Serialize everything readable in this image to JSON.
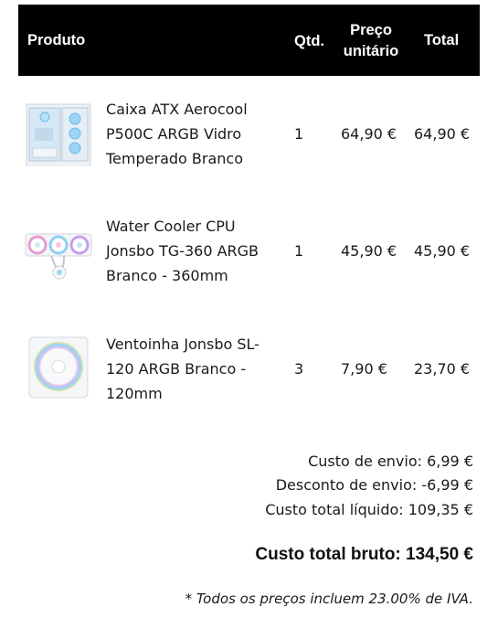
{
  "table": {
    "headers": {
      "product": "Produto",
      "qty": "Qtd.",
      "unit_price_line1": "Preço",
      "unit_price_line2": "unitário",
      "total": "Total"
    },
    "rows": [
      {
        "name_lines": [
          "Caixa ATX Aerocool",
          "P500C ARGB Vidro",
          "Temperado Branco"
        ],
        "qty": "1",
        "unit_price": "64,90 €",
        "total": "64,90 €",
        "image": "pc-case-thumbnail"
      },
      {
        "name_lines": [
          "Water Cooler CPU",
          "Jonsbo TG-360 ARGB",
          "Branco - 360mm"
        ],
        "qty": "1",
        "unit_price": "45,90 €",
        "total": "45,90 €",
        "image": "water-cooler-thumbnail"
      },
      {
        "name_lines": [
          "Ventoinha Jonsbo SL-",
          "120 ARGB Branco -",
          "120mm"
        ],
        "qty": "3",
        "unit_price": "7,90 €",
        "total": "23,70 €",
        "image": "fan-thumbnail"
      }
    ]
  },
  "summary": {
    "shipping": "Custo de envio: 6,99 €",
    "shipping_discount": "Desconto de envio: -6,99 €",
    "net_total": "Custo total líquido: 109,35 €",
    "gross_total": "Custo total bruto: 134,50 €",
    "vat_note": "* Todos os preços incluem 23.00% de IVA."
  },
  "colors": {
    "header_bg": "#000000",
    "header_text": "#ffffff",
    "text": "#1a1a1a"
  }
}
